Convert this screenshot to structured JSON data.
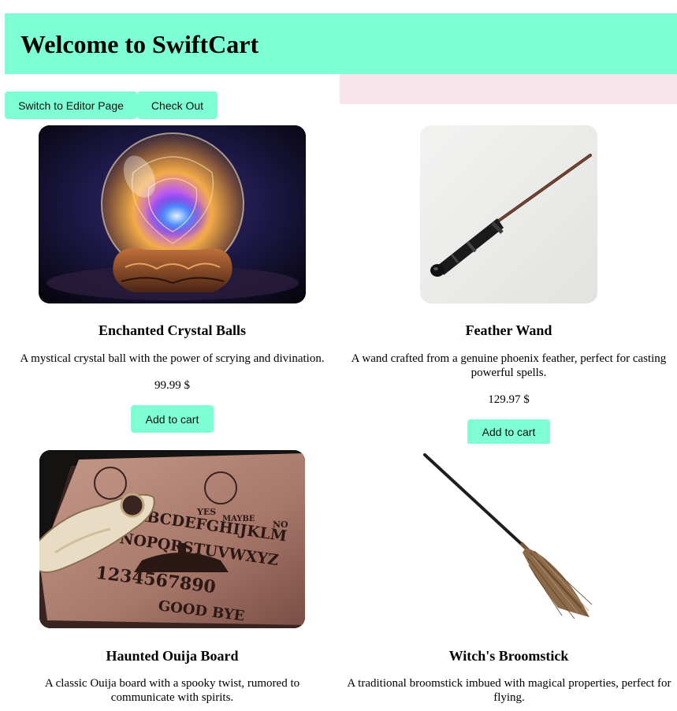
{
  "header": {
    "title": "Welcome to SwiftCart"
  },
  "nav": {
    "editor_label": "Switch to Editor Page",
    "checkout_label": "Check Out"
  },
  "products": [
    {
      "name": "Enchanted Crystal Balls",
      "description": "A mystical crystal ball with the power of scrying and divination.",
      "price": "99.99 $",
      "button": "Add to cart",
      "image_icon": "crystal-ball-icon"
    },
    {
      "name": "Feather Wand",
      "description": "A wand crafted from a genuine phoenix feather, perfect for casting powerful spells.",
      "price": "129.97 $",
      "button": "Add to cart",
      "image_icon": "wand-icon"
    },
    {
      "name": "Haunted Ouija Board",
      "description": "A classic Ouija board with a spooky twist, rumored to communicate with spirits.",
      "image_icon": "ouija-board-icon",
      "board_text": {
        "top_left": "YES",
        "top_middle": "MAYBE",
        "top_right": "NO",
        "row1": "ABCDEFGHIJKLM",
        "row2": "NOPQRSTUVWXYZ",
        "numbers": "1234567890",
        "bottom": "GOOD BYE"
      }
    },
    {
      "name": "Witch's Broomstick",
      "description": "A traditional broomstick imbued with magical properties, perfect for flying.",
      "image_icon": "broomstick-icon"
    }
  ],
  "colors": {
    "accent": "#7fffd4",
    "pink_strip": "#fae4ec"
  }
}
